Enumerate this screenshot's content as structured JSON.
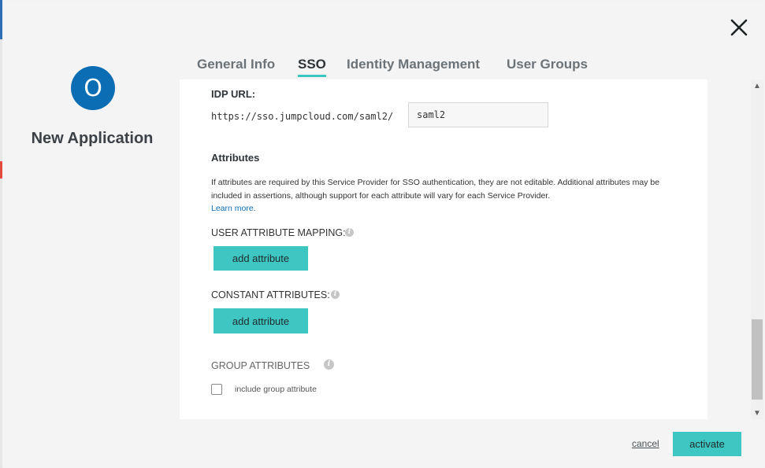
{
  "window": {
    "close_icon": "close-icon"
  },
  "app": {
    "avatar_initial": "O",
    "name": "New Application"
  },
  "tabs": [
    {
      "label": "General Info",
      "active": false
    },
    {
      "label": "SSO",
      "active": true
    },
    {
      "label": "Identity Management",
      "active": false
    },
    {
      "label": "User Groups",
      "active": false
    }
  ],
  "sso": {
    "idp_url_label": "IDP URL:",
    "idp_url_prefix": "https://sso.jumpcloud.com/saml2/",
    "idp_url_value": "saml2",
    "attributes_heading": "Attributes",
    "attributes_description": "If attributes are required by this Service Provider for SSO authentication, they are not editable. Additional attributes may be included in assertions, although support for each attribute will vary for each Service Provider.",
    "learn_more": "Learn more.",
    "user_attribute_mapping_label": "USER ATTRIBUTE MAPPING:",
    "add_attribute_label": "add attribute",
    "constant_attributes_label": "CONSTANT ATTRIBUTES:",
    "add_constant_attribute_label": "add attribute",
    "group_attributes_label": "GROUP ATTRIBUTES",
    "include_group_attribute_label": "include group attribute",
    "include_group_attribute_checked": false,
    "info_icon": "info-icon"
  },
  "footer": {
    "cancel_label": "cancel",
    "activate_label": "activate"
  },
  "colors": {
    "accent": "#3ec7c2",
    "brand": "#0b6db3"
  }
}
